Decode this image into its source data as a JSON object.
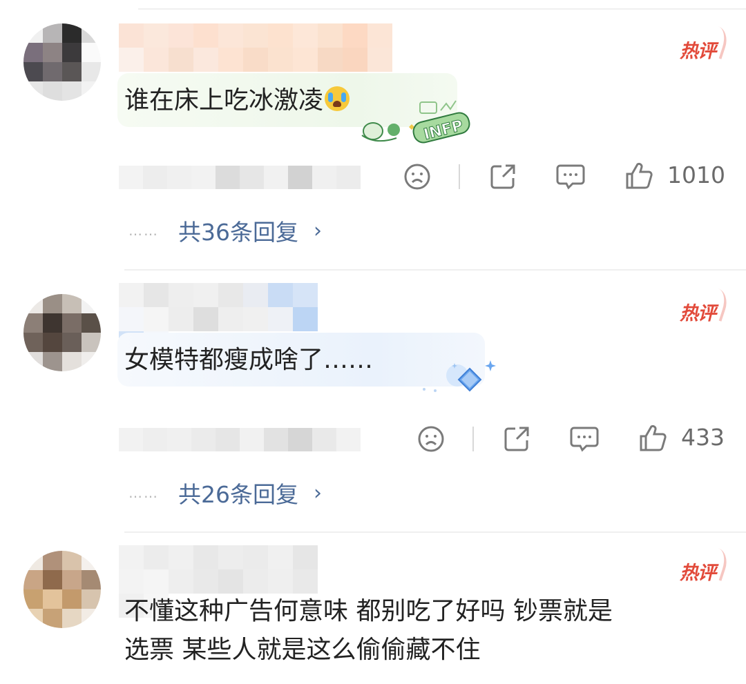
{
  "comments": [
    {
      "badge": "热评",
      "text": "谁在床上吃冰激凌",
      "decoration": "INFP",
      "like_count": "1010",
      "replies_label": "共36条回复",
      "dots": "……"
    },
    {
      "badge": "热评",
      "text": "女模特都瘦成啥了……",
      "like_count": "433",
      "replies_label": "共26条回复",
      "dots": "……"
    },
    {
      "badge": "热评",
      "text_line1": "不懂这种广告何意味 都别吃了好吗 钞票就是",
      "text_line2": "选票 某些人就是这么偷偷藏不住"
    }
  ],
  "colors": {
    "badge_red": "#e24a3a",
    "reply_link": "#4b6a97",
    "icon_gray": "#7a7a7a",
    "bubble_green": "#eef7ea",
    "bubble_blue": "#eaf2fc"
  },
  "icons": [
    "dislike-face-icon",
    "share-icon",
    "comment-icon",
    "thumbs-up-icon",
    "chevron-right-icon",
    "crying-emoji-icon"
  ]
}
